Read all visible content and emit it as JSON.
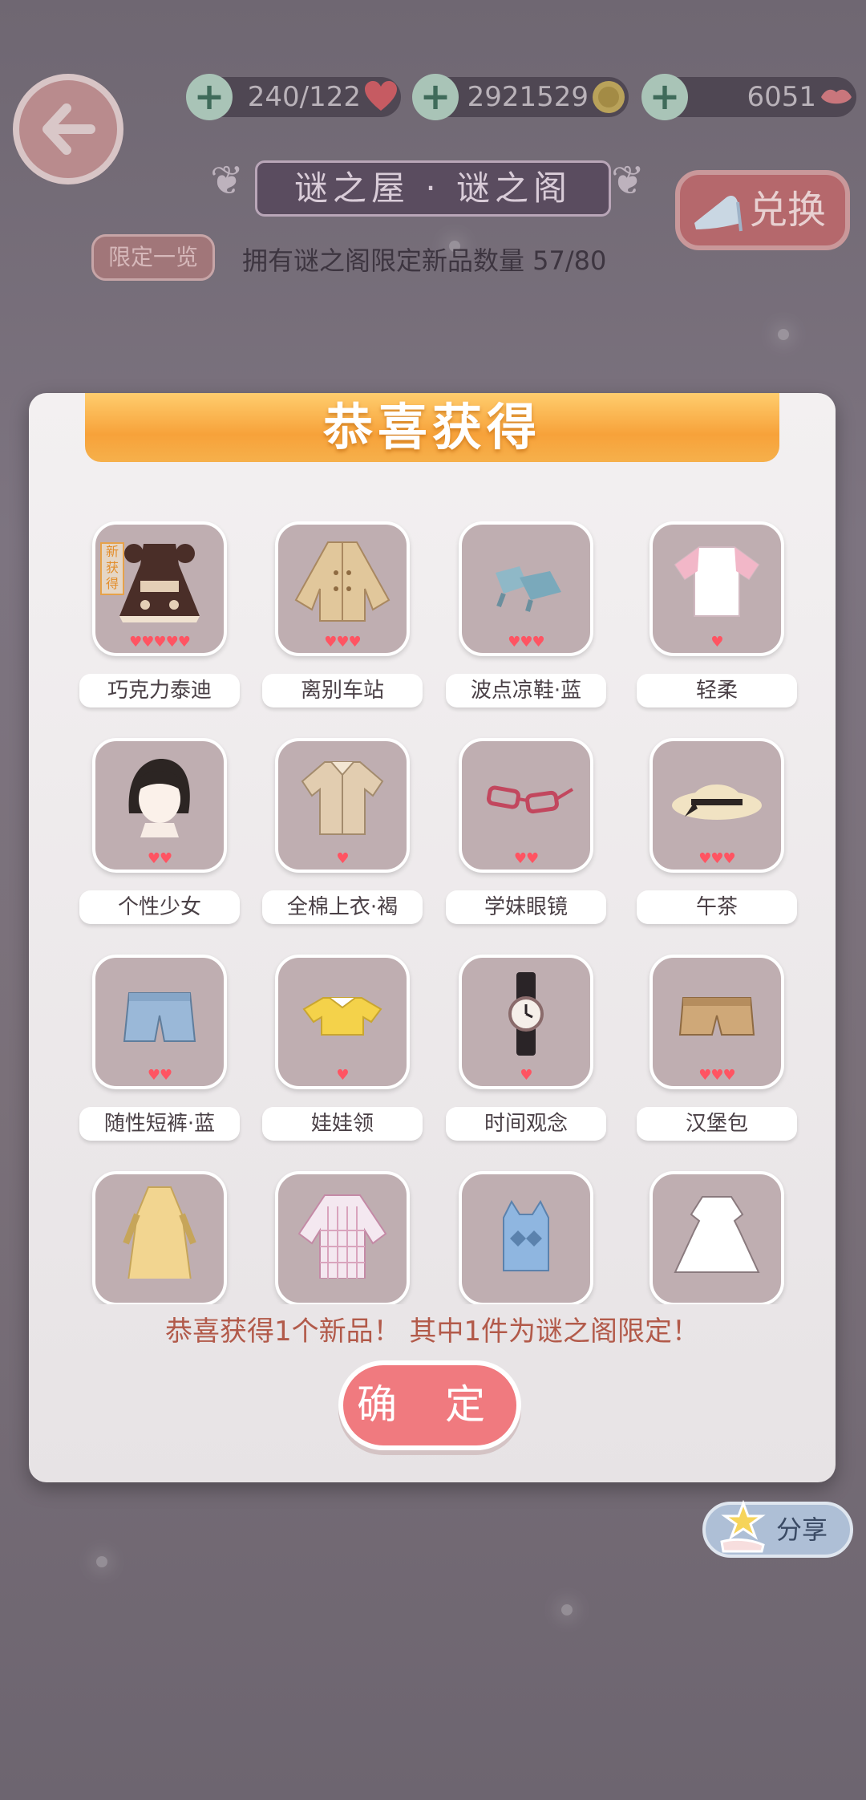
{
  "header": {
    "hearts_value": "240/122",
    "coins_value": "2921529",
    "diamonds_value": "6051",
    "title": "谜之屋 · 谜之阁",
    "limit_button": "限定一览",
    "own_text": "拥有谜之阁限定新品数量 57/80",
    "exchange_button": "兑换"
  },
  "dialog": {
    "banner": "恭喜获得",
    "new_tag": "新获得",
    "items": [
      {
        "label": "巧克力泰迪",
        "hearts": "♥♥♥♥♥",
        "icon": "dress-icon"
      },
      {
        "label": "离别车站",
        "hearts": "♥♥♥",
        "icon": "coat-icon"
      },
      {
        "label": "波点凉鞋·蓝",
        "hearts": "♥♥♥",
        "icon": "sandals-icon"
      },
      {
        "label": "轻柔",
        "hearts": "♥",
        "icon": "tshirt-icon"
      },
      {
        "label": "个性少女",
        "hearts": "♥♥",
        "icon": "hair-icon"
      },
      {
        "label": "全棉上衣·褐",
        "hearts": "♥",
        "icon": "shirt-icon"
      },
      {
        "label": "学妹眼镜",
        "hearts": "♥♥",
        "icon": "glasses-icon"
      },
      {
        "label": "午茶",
        "hearts": "♥♥♥",
        "icon": "hat-icon"
      },
      {
        "label": "随性短裤·蓝",
        "hearts": "♥♥",
        "icon": "shorts-icon"
      },
      {
        "label": "娃娃领",
        "hearts": "♥",
        "icon": "crop-top-icon"
      },
      {
        "label": "时间观念",
        "hearts": "♥",
        "icon": "watch-icon"
      },
      {
        "label": "汉堡包",
        "hearts": "♥♥♥",
        "icon": "brown-shorts-icon"
      },
      {
        "label": "",
        "hearts": "",
        "icon": "long-dress-icon"
      },
      {
        "label": "",
        "hearts": "",
        "icon": "plaid-shirt-icon"
      },
      {
        "label": "",
        "hearts": "",
        "icon": "vest-icon"
      },
      {
        "label": "",
        "hearts": "",
        "icon": "white-dress-icon"
      }
    ],
    "congrats_text": "恭喜获得1个新品！ 其中1件为谜之阁限定！",
    "ok_button": "确 定"
  },
  "share_button": "分享",
  "colors": {
    "heart": "#ff5462",
    "banner_orange": "#f7a23a",
    "ok_button": "#f07a7f",
    "tile_bg": "#bfaeb1"
  }
}
